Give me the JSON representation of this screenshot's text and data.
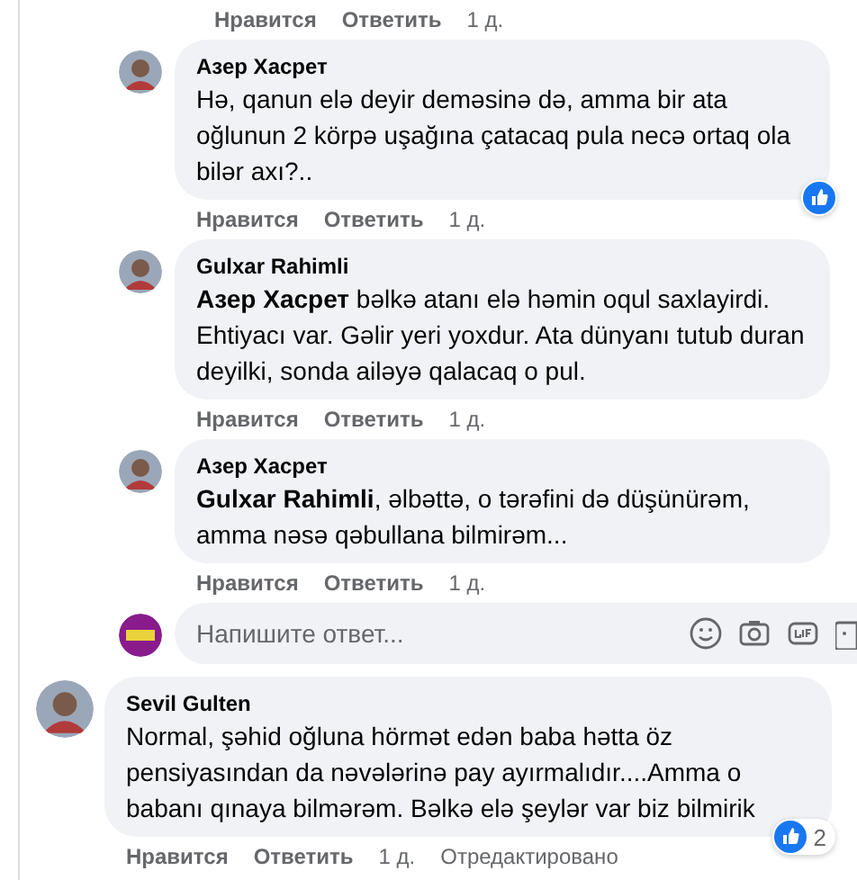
{
  "top_actions": {
    "like": "Нравится",
    "reply": "Ответить",
    "time": "1 д."
  },
  "replies": [
    {
      "author": "Азер Хасрет",
      "text": "Hə, qanun elə deyir deməsinə də, amma bir ata oğlunun 2 körpə uşağına çatacaq pula necə ortaq ola bilər axı?..",
      "reacted": true,
      "like": "Нравится",
      "reply": "Ответить",
      "time": "1 д."
    },
    {
      "author": "Gulxar Rahimli",
      "text": "**Азер Хасрет** bəlkə atanı elə həmin oqul saxlayirdi. Ehtiyacı var. Gəlir yeri yoxdur. Ata dünyanı tutub duran deyilki, sonda ailəyə qalacaq o pul.",
      "reacted": false,
      "like": "Нравится",
      "reply": "Ответить",
      "time": "1 д."
    },
    {
      "author": "Азер Хасрет",
      "text": "**Gulxar Rahimli**, əlbəttə, o tərəfini də düşünürəm, amma nəsə qəbullana bilmirəm...",
      "reacted": false,
      "like": "Нравится",
      "reply": "Ответить",
      "time": "1 д."
    }
  ],
  "reply_box": {
    "placeholder": "Напишите ответ..."
  },
  "comment": {
    "author": "Sevil Gulten",
    "text": "Normal, şəhid oğluna hörmət edən baba hətta öz pensiyasından da nəvələrinə pay ayırmalıdır....Amma o babanı qınaya bilmərəm. Bəlkə elə şeylər var biz bilmirik",
    "reaction_count": "2",
    "like": "Нравится",
    "reply": "Ответить",
    "time": "1 д.",
    "edited": "Отредактировано"
  }
}
